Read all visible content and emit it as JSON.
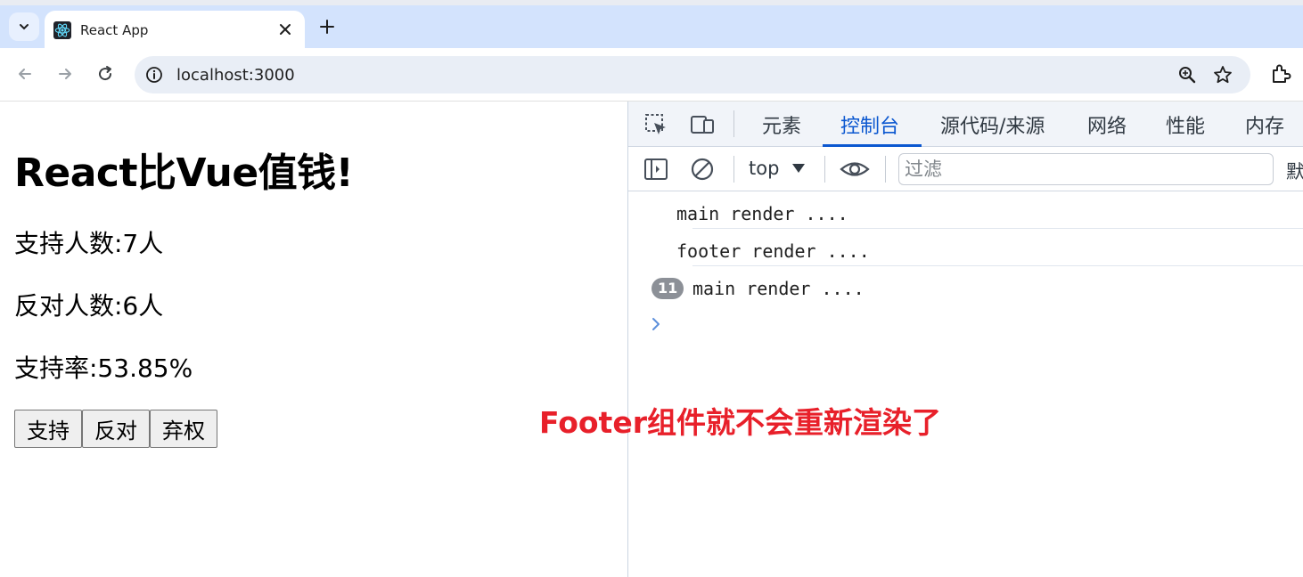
{
  "browser": {
    "tab_title": "React App",
    "url": "localhost:3000"
  },
  "page": {
    "title": "React比Vue值钱!",
    "support_line": "支持人数:7人",
    "oppose_line": "反对人数:6人",
    "rate_line": "支持率:53.85%",
    "buttons": {
      "support": "支持",
      "oppose": "反对",
      "abstain": "弃权"
    }
  },
  "devtools": {
    "tabs": [
      "元素",
      "控制台",
      "源代码/来源",
      "网络",
      "性能",
      "内存"
    ],
    "active_tab": "控制台",
    "context": "top",
    "filter_placeholder": "过滤",
    "levels_label": "默",
    "logs": [
      {
        "text": "main render ....",
        "count": null
      },
      {
        "text": "footer render ....",
        "count": null
      },
      {
        "text": "main render ....",
        "count": "11"
      }
    ]
  },
  "annotation": "Footer组件就不会重新渲染了",
  "colors": {
    "accent": "#0b57d0",
    "annotation": "#e8202a",
    "tabbar": "#d3e3fd"
  }
}
